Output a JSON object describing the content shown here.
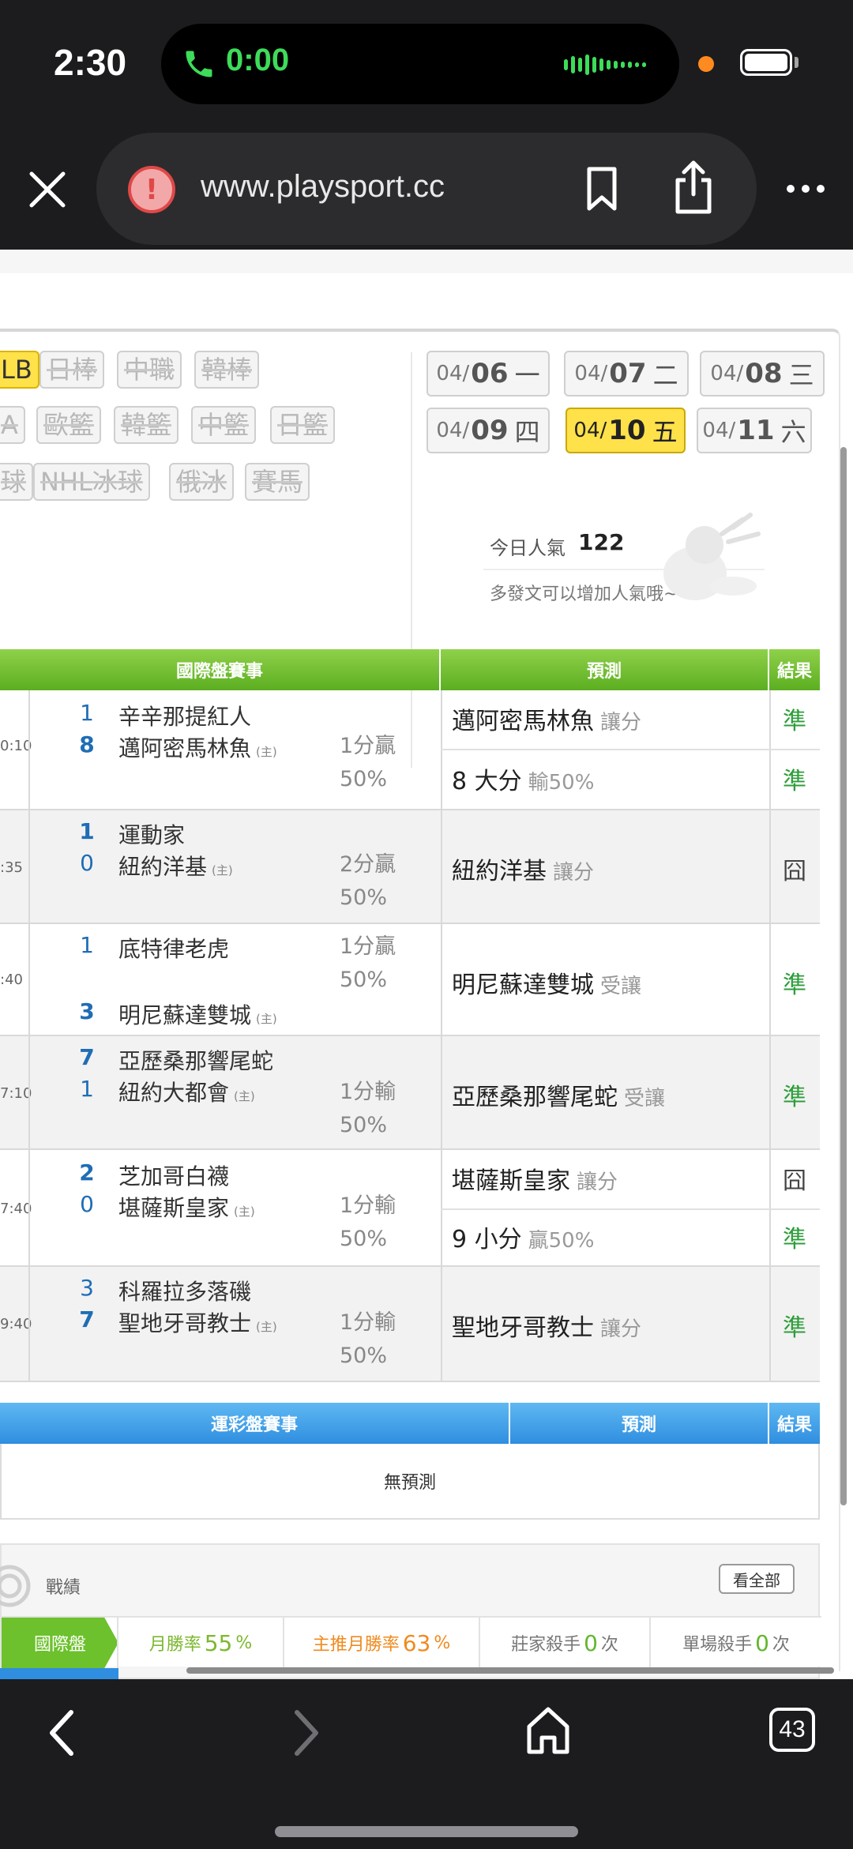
{
  "status_bar": {
    "time": "2:30",
    "call_time": "0:00"
  },
  "browser": {
    "url": "www.playsport.cc",
    "tabs_count": "43"
  },
  "sport_chips": [
    {
      "label": "LB",
      "active": true
    },
    {
      "label": "日棒",
      "active": false
    },
    {
      "label": "中職",
      "active": false
    },
    {
      "label": "韓棒",
      "active": false
    },
    {
      "label": "A",
      "active": false
    },
    {
      "label": "歐籃",
      "active": false
    },
    {
      "label": "韓籃",
      "active": false
    },
    {
      "label": "中籃",
      "active": false
    },
    {
      "label": "日籃",
      "active": false
    },
    {
      "label": "球",
      "active": false
    },
    {
      "label": "NHL冰球",
      "active": false
    },
    {
      "label": "俄冰",
      "active": false
    },
    {
      "label": "賽馬",
      "active": false
    }
  ],
  "dates": [
    {
      "md": "04/",
      "day": "06",
      "weekday": "一",
      "active": false
    },
    {
      "md": "04/",
      "day": "07",
      "weekday": "二",
      "active": false
    },
    {
      "md": "04/",
      "day": "08",
      "weekday": "三",
      "active": false
    },
    {
      "md": "04/",
      "day": "09",
      "weekday": "四",
      "active": false
    },
    {
      "md": "04/",
      "day": "10",
      "weekday": "五",
      "active": true
    },
    {
      "md": "04/",
      "day": "11",
      "weekday": "六",
      "active": false
    }
  ],
  "popularity": {
    "label": "今日人氣",
    "value": "122",
    "note": "多發文可以增加人氣哦~"
  },
  "intl_table": {
    "headers": {
      "games": "國際盤賽事",
      "prediction": "預測",
      "result": "結果"
    },
    "rows": [
      {
        "time": "0:10",
        "away_score": "1",
        "home_score": "8",
        "away": "辛辛那提紅人",
        "home": "邁阿密馬林魚",
        "home_tag": "(主)",
        "spread": "1分贏",
        "pct": "50%",
        "predictions": [
          {
            "text": "邁阿密馬林魚",
            "sub": "讓分",
            "outcome": "準"
          },
          {
            "text": "8 大分",
            "sub": "輸50%",
            "outcome": "準"
          }
        ]
      },
      {
        "time": ":35",
        "away_score": "1",
        "home_score": "0",
        "away": "運動家",
        "home": "紐約洋基",
        "home_tag": "(主)",
        "spread": "2分贏",
        "pct": "50%",
        "predictions": [
          {
            "text": "紐約洋基",
            "sub": "讓分",
            "outcome": "囧"
          }
        ]
      },
      {
        "time": ":40",
        "away_score": "1",
        "home_score": "3",
        "away": "底特律老虎",
        "home": "明尼蘇達雙城",
        "home_tag": "(主)",
        "spread": "1分贏",
        "pct": "50%",
        "predictions": [
          {
            "text": "明尼蘇達雙城",
            "sub": "受讓",
            "outcome": "準"
          }
        ]
      },
      {
        "time": "7:10",
        "away_score": "7",
        "home_score": "1",
        "away": "亞歷桑那響尾蛇",
        "home": "紐約大都會",
        "home_tag": "(主)",
        "spread": "1分輸",
        "pct": "50%",
        "predictions": [
          {
            "text": "亞歷桑那響尾蛇",
            "sub": "受讓",
            "outcome": "準"
          }
        ]
      },
      {
        "time": "7:40",
        "away_score": "2",
        "home_score": "0",
        "away": "芝加哥白襪",
        "home": "堪薩斯皇家",
        "home_tag": "(主)",
        "spread": "1分輸",
        "pct": "50%",
        "predictions": [
          {
            "text": "堪薩斯皇家",
            "sub": "讓分",
            "outcome": "囧"
          },
          {
            "text": "9 小分",
            "sub": "贏50%",
            "outcome": "準"
          }
        ]
      },
      {
        "time": "9:40",
        "away_score": "3",
        "home_score": "7",
        "away": "科羅拉多落磯",
        "home": "聖地牙哥教士",
        "home_tag": "(主)",
        "spread": "1分輸",
        "pct": "50%",
        "predictions": [
          {
            "text": "聖地牙哥教士",
            "sub": "讓分",
            "outcome": "準"
          }
        ]
      }
    ]
  },
  "lottery_table": {
    "headers": {
      "games": "運彩盤賽事",
      "prediction": "預測",
      "result": "結果"
    },
    "empty": "無預測"
  },
  "record": {
    "title": "戰績",
    "view_all": "看全部",
    "tag": "國際盤",
    "stats": [
      {
        "label": "月勝率",
        "value": "55",
        "unit": "%"
      },
      {
        "label": "主推月勝率",
        "value": "63",
        "unit": "%"
      },
      {
        "label": "莊家殺手",
        "value": "0",
        "unit": "次"
      },
      {
        "label": "單場殺手",
        "value": "0",
        "unit": "次"
      }
    ]
  },
  "colors": {
    "green_header": "#6cc12c",
    "blue_header": "#2f8ee0",
    "active_chip": "#ffe14a",
    "win": "#2e9d3a"
  }
}
